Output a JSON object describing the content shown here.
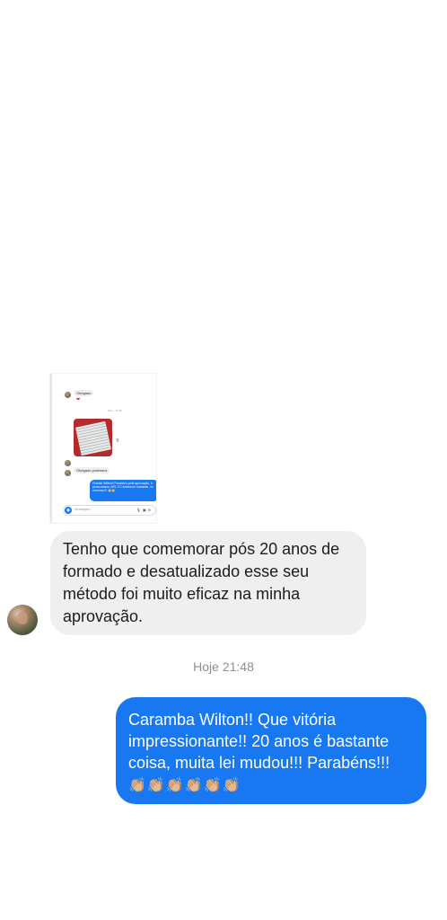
{
  "embedded_screenshot": {
    "message_1": "Obrigado",
    "reaction_1": "❤",
    "time": "hoje · 11:55",
    "message_2": "Obrigado professor",
    "sent_message": "Grande Wilton!! Parabéns pela aprovação, é pena estava .AP1 !!! Comemore bastante, vc mereceu!!! 👏👏",
    "composer_placeholder": "Mensagem..."
  },
  "conversation": {
    "incoming_message": "Tenho que comemorar pós 20 anos de formado e desatualizado esse seu método foi muito eficaz na minha aprovação.",
    "timestamp": "Hoje 21:48",
    "outgoing_message": "Caramba Wilton!! Que vitória impressionante!! 20 anos é bastante coisa, muita lei mudou!!! Parabéns!!!",
    "outgoing_emojis": [
      "👏🏼",
      "👏🏼",
      "👏🏼",
      "👏🏼",
      "👏🏼",
      "👏🏼"
    ]
  },
  "colors": {
    "outgoing_bubble": "#1778f2",
    "incoming_bubble": "#efefef",
    "timestamp_text": "#8e8e8e"
  }
}
